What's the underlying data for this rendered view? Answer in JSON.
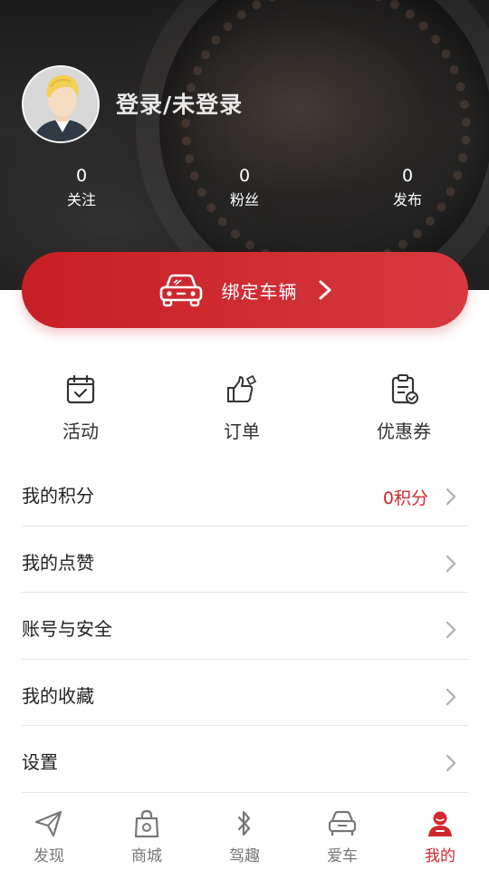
{
  "profile": {
    "username": "登录/未登录",
    "stats": [
      {
        "value": "0",
        "label": "关注"
      },
      {
        "value": "0",
        "label": "粉丝"
      },
      {
        "value": "0",
        "label": "发布"
      }
    ]
  },
  "bind_vehicle": {
    "label": "绑定车辆",
    "icon": "car-icon"
  },
  "quick_actions": [
    {
      "label": "活动",
      "icon": "calendar-check-icon"
    },
    {
      "label": "订单",
      "icon": "thumbs-up-icon"
    },
    {
      "label": "优惠券",
      "icon": "clipboard-check-icon"
    }
  ],
  "menu": [
    {
      "label": "我的积分",
      "value": "0积分"
    },
    {
      "label": "我的点赞",
      "value": ""
    },
    {
      "label": "账号与安全",
      "value": ""
    },
    {
      "label": "我的收藏",
      "value": ""
    },
    {
      "label": "设置",
      "value": ""
    }
  ],
  "tabbar": {
    "active_color": "#d0282e",
    "inactive_color": "#777777",
    "items": [
      {
        "label": "发现",
        "icon": "paper-plane-icon"
      },
      {
        "label": "商城",
        "icon": "shopping-bag-icon"
      },
      {
        "label": "驾趣",
        "icon": "bluetooth-icon"
      },
      {
        "label": "爱车",
        "icon": "car-front-icon"
      },
      {
        "label": "我的",
        "icon": "user-icon",
        "active": true
      }
    ]
  },
  "colors": {
    "accent": "#d0282e",
    "button_gradient_start": "#c81e25",
    "button_gradient_end": "#d63a40"
  }
}
